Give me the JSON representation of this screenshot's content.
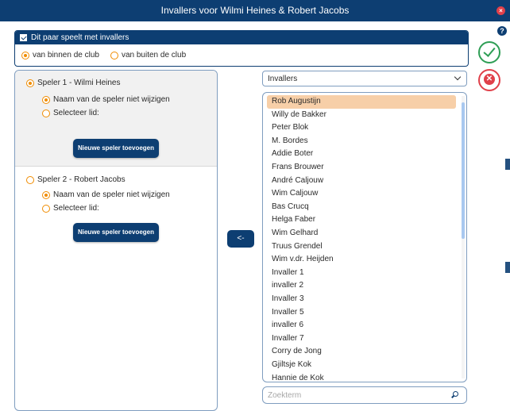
{
  "window": {
    "title": "Invallers voor Wilmi Heines & Robert Jacobs",
    "close_icon": "close-dot-icon",
    "help_icon": "?"
  },
  "group": {
    "checkbox_label": "Dit paar speelt met invallers",
    "checked": true,
    "options": [
      {
        "label": "van binnen de club",
        "selected": true
      },
      {
        "label": "van buiten de club",
        "selected": false
      }
    ]
  },
  "players": [
    {
      "label": "Speler 1 - Wilmi Heines",
      "selected": true,
      "options": [
        {
          "label": "Naam van de speler niet wijzigen",
          "selected": true
        },
        {
          "label": "Selecteer lid:",
          "selected": false
        }
      ],
      "button": "Nieuwe speler toevoegen"
    },
    {
      "label": "Speler 2 - Robert Jacobs",
      "selected": false,
      "options": [
        {
          "label": "Naam van de speler niet wijzigen",
          "selected": true
        },
        {
          "label": "Selecteer lid:",
          "selected": false
        }
      ],
      "button": "Nieuwe speler toevoegen"
    }
  ],
  "transfer_button": "<-",
  "dropdown": {
    "value": "Invallers"
  },
  "list": {
    "selected_index": 0,
    "items": [
      "Rob Augustijn",
      "Willy de Bakker",
      "Peter Blok",
      "M. Bordes",
      "Addie Boter",
      "Frans Brouwer",
      "André Caljouw",
      "Wim Caljouw",
      "Bas Crucq",
      "Helga Faber",
      "Wim Gelhard",
      "Truus Grendel",
      "Wim v.dr. Heijden",
      "Invaller 1",
      "invaller 2",
      "Invaller 3",
      "Invaller 5",
      "invaller 6",
      "Invaller 7",
      "Corry de Jong",
      "Gjiltsje Kok",
      "Hannie de Kok"
    ]
  },
  "search": {
    "placeholder": "Zoekterm",
    "value": ""
  },
  "colors": {
    "primary": "#0d3e72",
    "accent": "#f08c00",
    "ok": "#2e9e55",
    "cancel": "#e0404a",
    "selection": "#f7cfa8"
  }
}
